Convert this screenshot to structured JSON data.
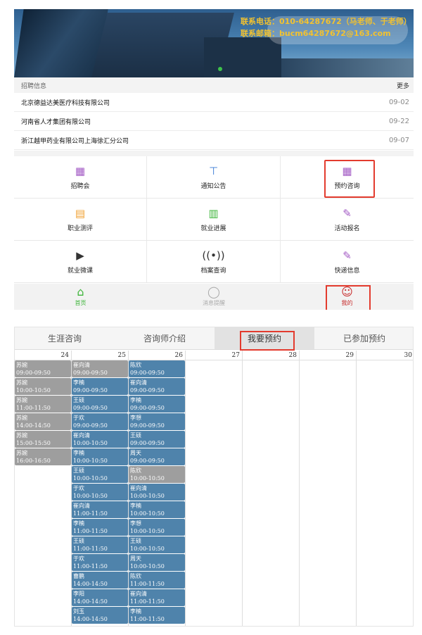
{
  "banner": {
    "contact_line1": "联系电话：010-64287672（马老师、于老师）",
    "contact_line2": "联系邮箱：bucm64287672@163.com"
  },
  "recruit": {
    "section_title": "招聘信息",
    "more_label": "更多",
    "items": [
      {
        "company": "北京德益达美医疗科技有限公司",
        "date": "09-02"
      },
      {
        "company": "河南省人才集团有限公司",
        "date": "09-22"
      },
      {
        "company": "浙江越甲药业有限公司上海徐汇分公司",
        "date": "09-07"
      }
    ]
  },
  "menu": {
    "items": [
      {
        "label": "招聘会",
        "icon": "calendar-icon",
        "color": "#a259c4"
      },
      {
        "label": "通知公告",
        "icon": "signboard-icon",
        "color": "#3a7bd5"
      },
      {
        "label": "预约咨询",
        "icon": "calendar-icon",
        "color": "#a259c4"
      },
      {
        "label": "职业测评",
        "icon": "clipboard-icon",
        "color": "#f0a030"
      },
      {
        "label": "就业进展",
        "icon": "document-icon",
        "color": "#3fb53b"
      },
      {
        "label": "活动报名",
        "icon": "edit-icon",
        "color": "#a259c4"
      },
      {
        "label": "就业微课",
        "icon": "video-icon",
        "color": "#333333"
      },
      {
        "label": "档案查询",
        "icon": "broadcast-icon",
        "color": "#333333"
      },
      {
        "label": "快递信息",
        "icon": "edit-icon",
        "color": "#a259c4"
      }
    ]
  },
  "tabbar": {
    "home_label": "首页",
    "messages_label": "消息提醒",
    "mine_label": "我的"
  },
  "schedule": {
    "tabs": [
      "生涯咨询",
      "咨询师介绍",
      "我要预约",
      "已参加预约"
    ],
    "days": [
      "24",
      "25",
      "26",
      "27",
      "28",
      "29",
      "30"
    ],
    "columns": [
      [
        {
          "name": "苏婉",
          "time": "09:00-09:50",
          "status": "gray"
        },
        {
          "name": "苏婉",
          "time": "10:00-10:50",
          "status": "gray"
        },
        {
          "name": "苏婉",
          "time": "11:00-11:50",
          "status": "gray"
        },
        {
          "name": "苏婉",
          "time": "14:00-14:50",
          "status": "gray"
        },
        {
          "name": "苏婉",
          "time": "15:00-15:50",
          "status": "gray"
        },
        {
          "name": "苏婉",
          "time": "16:00-16:50",
          "status": "gray"
        }
      ],
      [
        {
          "name": "崔向清",
          "time": "09:00-09:50",
          "status": "gray"
        },
        {
          "name": "李楠",
          "time": "09:00-09:50",
          "status": "blue"
        },
        {
          "name": "王硕",
          "time": "09:00-09:50",
          "status": "blue"
        },
        {
          "name": "于欢",
          "time": "09:00-09:50",
          "status": "blue"
        },
        {
          "name": "崔向清",
          "time": "10:00-10:50",
          "status": "blue"
        },
        {
          "name": "李楠",
          "time": "10:00-10:50",
          "status": "blue"
        },
        {
          "name": "王硕",
          "time": "10:00-10:50",
          "status": "blue"
        },
        {
          "name": "于欢",
          "time": "10:00-10:50",
          "status": "blue"
        },
        {
          "name": "崔向清",
          "time": "11:00-11:50",
          "status": "blue"
        },
        {
          "name": "李楠",
          "time": "11:00-11:50",
          "status": "blue"
        },
        {
          "name": "王硕",
          "time": "11:00-11:50",
          "status": "blue"
        },
        {
          "name": "于欢",
          "time": "11:00-11:50",
          "status": "blue"
        },
        {
          "name": "曹鹏",
          "time": "14:00-14:50",
          "status": "blue"
        },
        {
          "name": "李阳",
          "time": "14:00-14:50",
          "status": "blue"
        },
        {
          "name": "刘玉",
          "time": "14:00-14:50",
          "status": "blue"
        }
      ],
      [
        {
          "name": "陈欣",
          "time": "09:00-09:50",
          "status": "blue"
        },
        {
          "name": "崔向清",
          "time": "09:00-09:50",
          "status": "blue"
        },
        {
          "name": "李楠",
          "time": "09:00-09:50",
          "status": "blue"
        },
        {
          "name": "李想",
          "time": "09:00-09:50",
          "status": "blue"
        },
        {
          "name": "王硕",
          "time": "09:00-09:50",
          "status": "blue"
        },
        {
          "name": "周天",
          "time": "09:00-09:50",
          "status": "blue"
        },
        {
          "name": "陈欣",
          "time": "10:00-10:50",
          "status": "gray"
        },
        {
          "name": "崔向清",
          "time": "10:00-10:50",
          "status": "blue"
        },
        {
          "name": "李楠",
          "time": "10:00-10:50",
          "status": "blue"
        },
        {
          "name": "李想",
          "time": "10:00-10:50",
          "status": "blue"
        },
        {
          "name": "王硕",
          "time": "10:00-10:50",
          "status": "blue"
        },
        {
          "name": "周天",
          "time": "10:00-10:50",
          "status": "blue"
        },
        {
          "name": "陈欣",
          "time": "11:00-11:50",
          "status": "blue"
        },
        {
          "name": "崔向清",
          "time": "11:00-11:50",
          "status": "blue"
        },
        {
          "name": "李楠",
          "time": "11:00-11:50",
          "status": "blue"
        }
      ],
      [],
      [],
      [],
      []
    ]
  }
}
